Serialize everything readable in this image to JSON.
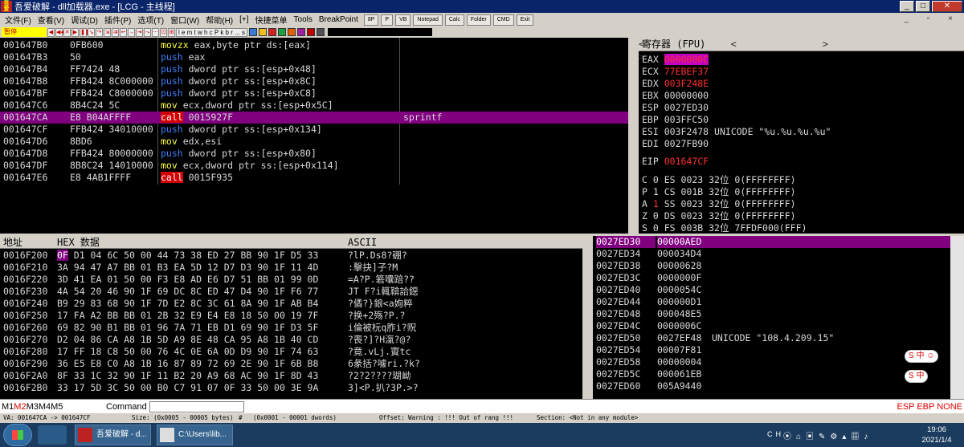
{
  "window": {
    "title": "吾爱破解 - dll加载器.exe - [LCG - 主线程]",
    "controls": [
      "_",
      "□",
      "✕"
    ]
  },
  "menu": {
    "items": [
      "文件(F)",
      "查看(V)",
      "调试(D)",
      "插件(P)",
      "选项(T)",
      "窗口(W)",
      "帮助(H)",
      "[+]",
      "快捷菜单",
      "Tools",
      "BreakPoint"
    ],
    "tools": [
      "8P",
      "P",
      "VB",
      "Notepad",
      "Calc",
      "Folder",
      "CMD",
      "Exit"
    ],
    "right": "_ ▫ ×"
  },
  "toolbar": {
    "status": "暂停",
    "letters": "l e m t w h c P k b r ... s"
  },
  "disasm": {
    "rows": [
      {
        "addr": "001647B0",
        "hex": "0FB600",
        "mn": "movzx",
        "ops": "eax,byte ptr ds:[eax]",
        "cm": ""
      },
      {
        "addr": "001647B3",
        "hex": "50",
        "mn": "push",
        "ops": "eax",
        "cm": ""
      },
      {
        "addr": "001647B4",
        "hex": "FF7424 48",
        "mn": "push",
        "ops": "dword ptr ss:[esp+0x48]",
        "cm": ""
      },
      {
        "addr": "001647B8",
        "hex": "FFB424 8C000000",
        "mn": "push",
        "ops": "dword ptr ss:[esp+0x8C]",
        "cm": ""
      },
      {
        "addr": "001647BF",
        "hex": "FFB424 C8000000",
        "mn": "push",
        "ops": "dword ptr ss:[esp+0xC8]",
        "cm": ""
      },
      {
        "addr": "001647C6",
        "hex": "8B4C24 5C",
        "mn": "mov",
        "ops": "ecx,dword ptr ss:[esp+0x5C]",
        "cm": ""
      },
      {
        "addr": "001647CA",
        "hex": "E8 B04AFFFF",
        "mn": "call",
        "ops": "0015927F",
        "cm": "sprintf",
        "sel": true
      },
      {
        "addr": "001647CF",
        "hex": "FFB424 34010000",
        "mn": "push",
        "ops": "dword ptr ss:[esp+0x134]",
        "cm": ""
      },
      {
        "addr": "001647D6",
        "hex": "8BD6",
        "mn": "mov",
        "ops": "edx,esi",
        "cm": ""
      },
      {
        "addr": "001647D8",
        "hex": "FFB424 80000000",
        "mn": "push",
        "ops": "dword ptr ss:[esp+0x80]",
        "cm": ""
      },
      {
        "addr": "001647DF",
        "hex": "8B8C24 14010000",
        "mn": "mov",
        "ops": "ecx,dword ptr ss:[esp+0x114]",
        "cm": ""
      },
      {
        "addr": "001647E6",
        "hex": "E8 4AB1FFFF",
        "mn": "call",
        "ops": "0015F935",
        "cm": ""
      }
    ]
  },
  "registers": {
    "header": "寄存器 (FPU)",
    "gp": [
      {
        "n": "EAX",
        "v": "0000000C",
        "hl": "flag",
        "cm": ""
      },
      {
        "n": "ECX",
        "v": "77EBEF37",
        "hl": "red",
        "cm": ""
      },
      {
        "n": "EDX",
        "v": "003F248E",
        "hl": "red",
        "cm": ""
      },
      {
        "n": "EBX",
        "v": "00000000",
        "hl": "",
        "cm": ""
      },
      {
        "n": "ESP",
        "v": "0027ED30",
        "hl": "",
        "cm": ""
      },
      {
        "n": "EBP",
        "v": "003FFC50",
        "hl": "",
        "cm": ""
      },
      {
        "n": "ESI",
        "v": "003F2478",
        "hl": "",
        "cm": "UNICODE \"%u.%u.%u.%u\""
      },
      {
        "n": "EDI",
        "v": "0027FB90",
        "hl": "",
        "cm": ""
      }
    ],
    "eip": {
      "n": "EIP",
      "v": "001647CF"
    },
    "flags": [
      {
        "f": "C",
        "b": "0",
        "seg": "ES 0023 32位 0(FFFFFFFF)",
        "red": false
      },
      {
        "f": "P",
        "b": "1",
        "seg": "CS 001B 32位 0(FFFFFFFF)",
        "red": false
      },
      {
        "f": "A",
        "b": "1",
        "seg": "SS 0023 32位 0(FFFFFFFF)",
        "red": true
      },
      {
        "f": "Z",
        "b": "0",
        "seg": "DS 0023 32位 0(FFFFFFFF)",
        "red": false
      },
      {
        "f": "S",
        "b": "0",
        "seg": "FS 003B 32位 7FFDF000(FFF)",
        "red": false
      }
    ]
  },
  "hex": {
    "h_addr": "地址",
    "h_hex": "HEX 数据",
    "h_ascii": "ASCII",
    "rows": [
      {
        "a": "0016F200",
        "first": "0F",
        "h": " D1 04 6C 50 00 44 73 38 ED 27 BB 90 1F D5 33",
        "s": "?lP.Ds8?硼?"
      },
      {
        "a": "0016F210",
        "first": "",
        "h": "3A 94 47 A7 BB 01 B3 EA 5D 12 D7 D3 90 1F 11 4D",
        "s": ":擊\u0001抉]\u0012子?\u0011M"
      },
      {
        "a": "0016F220",
        "first": "",
        "h": "3D 41 EA 01 50 00 F3 E8 AD E6 D7 51 BB 01 99 0D",
        "s": "=A?P.箬囔踣??"
      },
      {
        "a": "0016F230",
        "first": "",
        "h": "4A 54 20 46 90 1F 69 DC 8C ED 47 D4 90 1F F6 77",
        "s": "JT F?i輒鞥詥鐚"
      },
      {
        "a": "0016F240",
        "first": "",
        "h": "B9 29 83 68 90 1F 7D E2 8C 3C 61 8A 90 1F AB B4",
        "s": "?僪?}鋃<a姁粹"
      },
      {
        "a": "0016F250",
        "first": "",
        "h": "17 FA A2 BB BB 01 2B 32 E9 E4 E8 18 50 00 19 7F",
        "s": "?换\u0001+2殇?P.?"
      },
      {
        "a": "0016F260",
        "first": "",
        "h": "69 82 90 B1 BB 01 96 7A 71 EB D1 69 90 1F D3 5F",
        "s": "i倫被\u0001杬q胙i?贶"
      },
      {
        "a": "0016F270",
        "first": "",
        "h": "D2 04 86 CA A8 1B 5D A9 8E 48 CA 95 A8 1B 40 CD",
        "s": "?\u0004喪?]?H滊?@?"
      },
      {
        "a": "0016F280",
        "first": "",
        "h": "17 FF 18 C8 50 00 76 4C 0E 6A 0D D9 90 1F 74 63",
        "s": "?\u0018竟.vL\u000ej.賨tc"
      },
      {
        "a": "0016F290",
        "first": "",
        "h": "36 E5 E8 C0 A8 1B 16 87 89 72 69 2E 90 1F 6B B8",
        "s": "6彖括?\u0016噱ri.?k?"
      },
      {
        "a": "0016F2A0",
        "first": "",
        "h": "8F 33 1C 32 90 1F 11 B2 20 A9 68 AC 90 1F 8D 43",
        "s": "?2?2?\u0011???瑚岰"
      },
      {
        "a": "0016F2B0",
        "first": "",
        "h": "33 17 5D 3C 50 00 B0 C7 91 07 0F 33 50 00 3E 9A",
        "s": "3\u0017]<P.扒?\u00073P.>?"
      }
    ]
  },
  "stack": {
    "rows": [
      {
        "a": "0027ED30",
        "v": "00000AED",
        "cm": "",
        "sel": true
      },
      {
        "a": "0027ED34",
        "v": "000034D4",
        "cm": ""
      },
      {
        "a": "0027ED38",
        "v": "00000628",
        "cm": ""
      },
      {
        "a": "0027ED3C",
        "v": "0000000F",
        "cm": ""
      },
      {
        "a": "0027ED40",
        "v": "0000054C",
        "cm": ""
      },
      {
        "a": "0027ED44",
        "v": "000000D1",
        "cm": ""
      },
      {
        "a": "0027ED48",
        "v": "000048E5",
        "cm": ""
      },
      {
        "a": "0027ED4C",
        "v": "0000006C",
        "cm": ""
      },
      {
        "a": "0027ED50",
        "v": "0027EF48",
        "cm": "UNICODE \"108.4.209.15\""
      },
      {
        "a": "0027ED54",
        "v": "00007F81",
        "cm": ""
      },
      {
        "a": "0027ED58",
        "v": "00000004",
        "cm": ""
      },
      {
        "a": "0027ED5C",
        "v": "000061EB",
        "cm": ""
      },
      {
        "a": "0027ED60",
        "v": "005A9440",
        "cm": ""
      }
    ]
  },
  "cmd": {
    "tabs": [
      "M1",
      "M2",
      "M3",
      "M4",
      "M5"
    ],
    "label": "Command",
    "esp": "ESP EBP NONE"
  },
  "status": {
    "a": "VA: 001647CA -> 001647CF",
    "b": "Size: (0x0005 - 00005 bytes)",
    "c": "#",
    "d": "(0x0001 - 00001 dwords)",
    "e": "Offset: Warning : !!! Out of rang !!!",
    "f": "Section: <Not in any module>"
  },
  "taskbar": {
    "tasks": [
      "吾爱破解 - d...",
      "C:\\Users\\lib..."
    ],
    "tray": "CH",
    "time": "19:06",
    "date": "2021/1/4"
  },
  "colors": {
    "selection": "#800080",
    "call_bg": "#d20000",
    "push": "#4080ff",
    "mov": "#ffff40",
    "red": "#ff3030"
  }
}
